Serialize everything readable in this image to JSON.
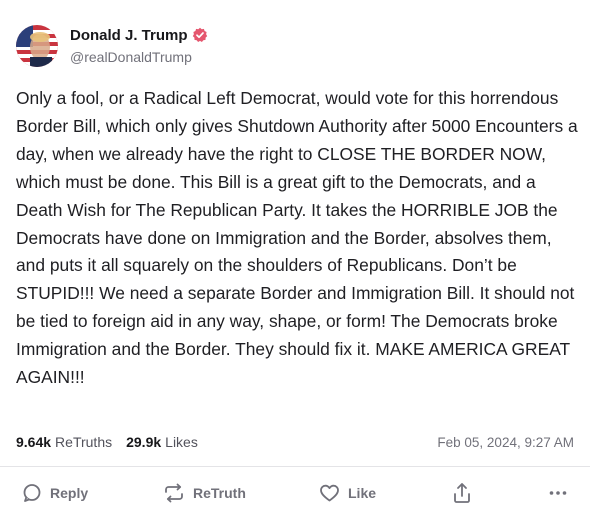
{
  "author": {
    "display_name": "Donald J. Trump",
    "handle": "@realDonaldTrump",
    "avatar_icon": "flag-portrait-avatar",
    "verified_icon": "verified-badge-icon",
    "verified_color": "#e5566e"
  },
  "post": {
    "text": "Only a fool, or a Radical Left Democrat, would vote for this horrendous Border Bill, which only gives Shutdown Authority after 5000 Encounters a day, when we already have the right to CLOSE THE BORDER NOW, which must be done. This Bill is a great gift to the Democrats, and a Death Wish for The Republican Party. It takes the HORRIBLE JOB the Democrats have done on Immigration and the Border, absolves them, and puts it all squarely on the shoulders of Republicans. Don’t be STUPID!!! We need a separate Border and Immigration Bill. It should not be tied to foreign aid in any way, shape, or form! The Democrats broke Immigration and the Border. They should fix it. MAKE AMERICA GREAT AGAIN!!!"
  },
  "stats": {
    "retruths_count": "9.64k",
    "retruths_label": "ReTruths",
    "likes_count": "29.9k",
    "likes_label": "Likes",
    "timestamp": "Feb 05, 2024, 9:27 AM"
  },
  "actions": {
    "reply": {
      "label": "Reply",
      "icon": "reply-icon"
    },
    "retruth": {
      "label": "ReTruth",
      "icon": "retruth-icon"
    },
    "like": {
      "label": "Like",
      "icon": "heart-icon"
    },
    "share": {
      "icon": "share-icon"
    },
    "more": {
      "icon": "more-icon"
    }
  },
  "colors": {
    "text": "#1f1f23",
    "muted": "#71717a",
    "divider": "#e4e4e7"
  }
}
